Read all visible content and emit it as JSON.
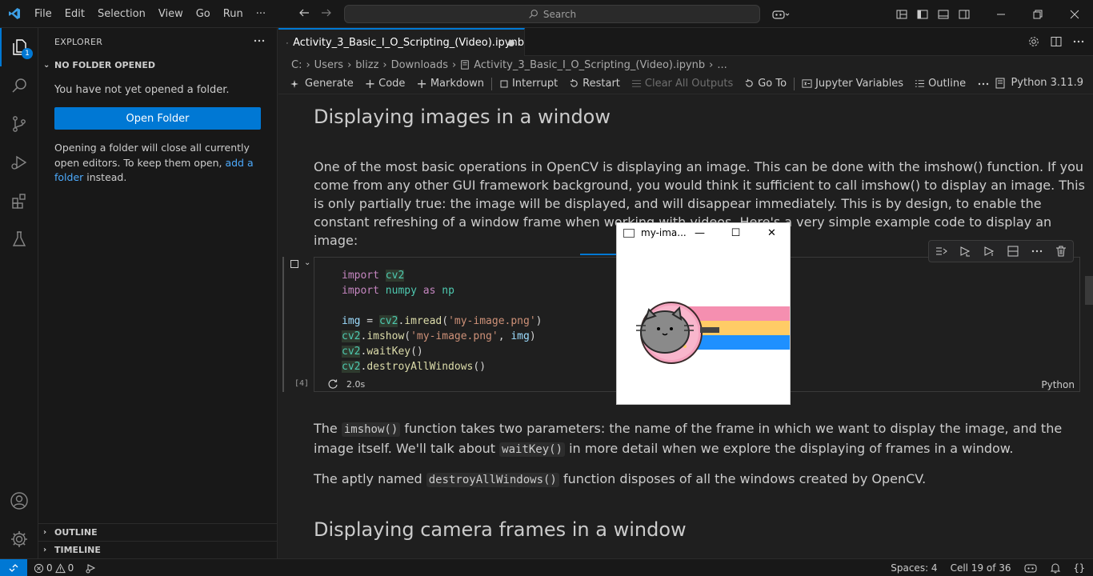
{
  "menu": [
    "File",
    "Edit",
    "Selection",
    "View",
    "Go",
    "Run",
    "···"
  ],
  "search": {
    "label": "Search"
  },
  "activity": {
    "explorer_badge": "1"
  },
  "sidebar": {
    "title": "EXPLORER",
    "section": "NO FOLDER OPENED",
    "message": "You have not yet opened a folder.",
    "open_button": "Open Folder",
    "note_part1": "Opening a folder will close all currently open editors. To keep them open, ",
    "note_link": "add a folder",
    "note_part2": " instead.",
    "outline": "OUTLINE",
    "timeline": "TIMELINE"
  },
  "tab": {
    "title": "Activity_3_Basic_I_O_Scripting_(Video).ipynb"
  },
  "breadcrumb": [
    "C:",
    "Users",
    "blizz",
    "Downloads",
    "Activity_3_Basic_I_O_Scripting_(Video).ipynb",
    "..."
  ],
  "toolbar": {
    "generate": "Generate",
    "code": "Code",
    "markdown": "Markdown",
    "interrupt": "Interrupt",
    "restart": "Restart",
    "clear": "Clear All Outputs",
    "goto": "Go To",
    "variables": "Jupyter Variables",
    "outline": "Outline",
    "kernel": "Python 3.11.9"
  },
  "notebook": {
    "heading1": "Displaying images in a window",
    "para1": "One of the most basic operations in OpenCV is displaying an image. This can be done with the imshow() function. If you come from any other GUI framework background, you would think it sufficient to call imshow() to display an image. This is only partially true: the image will be displayed, and will disappear immediately. This is by design, to enable the constant refreshing of a window frame when working with videos. Here's a very simple example code to display an image:",
    "exec_count": "[4]",
    "exec_time": "2.0s",
    "cell_lang": "Python",
    "para2_a": "The ",
    "para2_code1": "imshow()",
    "para2_b": " function takes two parameters: the name of the frame in which we want to display the image, and the image itself. We'll talk about ",
    "para2_code2": "waitKey()",
    "para2_c": " in more detail when we explore the displaying of frames in a window.",
    "para3_a": "The aptly named ",
    "para3_code": "destroyAllWindows()",
    "para3_b": " function disposes of all the windows created by OpenCV.",
    "heading2": "Displaying camera frames in a window"
  },
  "popup": {
    "title": "my-ima..."
  },
  "status": {
    "errors": "0",
    "warnings": "0",
    "spaces": "Spaces: 4",
    "cell": "Cell 19 of 36"
  },
  "colors": {
    "accent": "#0078d4",
    "background": "#1f1f1f",
    "sidebar": "#181818"
  }
}
